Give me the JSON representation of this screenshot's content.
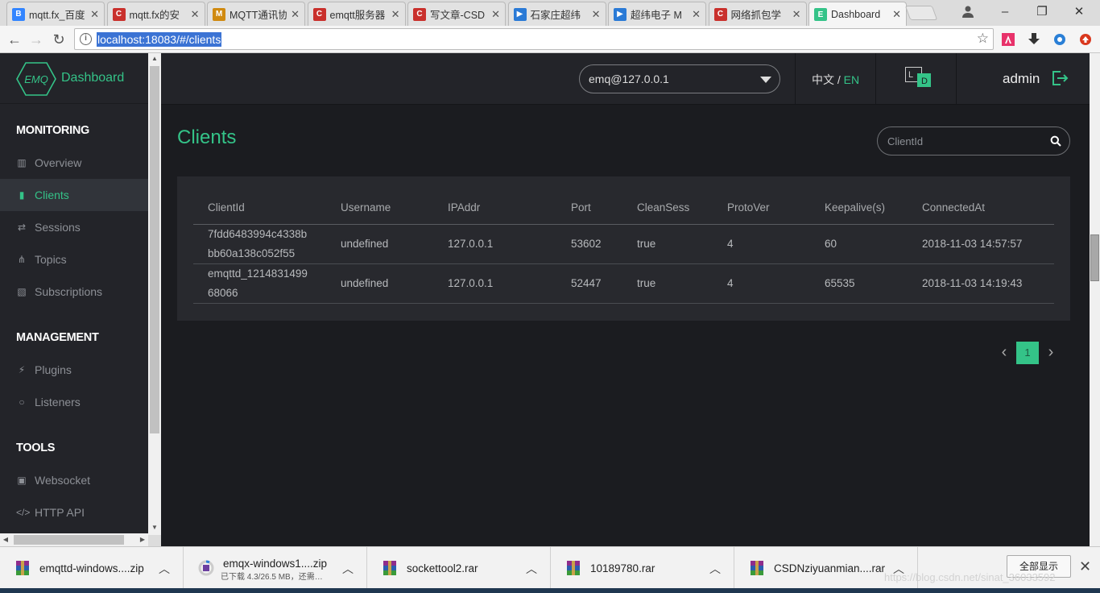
{
  "browser": {
    "tabs": [
      {
        "title": "mqtt.fx_百度",
        "icon": "baidu-icon",
        "color": "#3385ff",
        "glyph": "B"
      },
      {
        "title": "mqtt.fx的安",
        "icon": "csdn-icon",
        "color": "#c9302c",
        "glyph": "C"
      },
      {
        "title": "MQTT通讯协",
        "icon": "mqtt-icon",
        "color": "#d08a10",
        "glyph": "M"
      },
      {
        "title": "emqtt服务器",
        "icon": "csdn-icon",
        "color": "#c9302c",
        "glyph": "C"
      },
      {
        "title": "写文章-CSD",
        "icon": "csdn-icon",
        "color": "#c9302c",
        "glyph": "C"
      },
      {
        "title": "石家庄超纬",
        "icon": "play-icon",
        "color": "#2a7ad6",
        "glyph": "▶"
      },
      {
        "title": "超纬电子 M",
        "icon": "play-icon",
        "color": "#2a7ad6",
        "glyph": "▶"
      },
      {
        "title": "网络抓包学",
        "icon": "csdn-icon",
        "color": "#c9302c",
        "glyph": "C"
      },
      {
        "title": "Dashboard",
        "icon": "emq-icon",
        "color": "#34c388",
        "glyph": "E"
      }
    ],
    "url": "localhost:18083/#/clients"
  },
  "sidebar": {
    "brand_logo": "EMQ",
    "brand_name": "Dashboard",
    "sections": [
      {
        "title": "MONITORING",
        "items": [
          {
            "label": "Overview",
            "icon": "bar-chart-icon",
            "glyph": "▥"
          },
          {
            "label": "Clients",
            "icon": "clients-icon",
            "glyph": "▮",
            "active": true
          },
          {
            "label": "Sessions",
            "icon": "swap-icon",
            "glyph": "⇄"
          },
          {
            "label": "Topics",
            "icon": "topics-icon",
            "glyph": "⋔"
          },
          {
            "label": "Subscriptions",
            "icon": "subscriptions-icon",
            "glyph": "▧"
          }
        ]
      },
      {
        "title": "MANAGEMENT",
        "items": [
          {
            "label": "Plugins",
            "icon": "plug-icon",
            "glyph": "⚡"
          },
          {
            "label": "Listeners",
            "icon": "listeners-icon",
            "glyph": "○"
          }
        ]
      },
      {
        "title": "TOOLS",
        "items": [
          {
            "label": "Websocket",
            "icon": "html5-icon",
            "glyph": "▣"
          },
          {
            "label": "HTTP API",
            "icon": "code-icon",
            "glyph": "</>"
          }
        ]
      }
    ]
  },
  "header": {
    "node": "emq@127.0.0.1",
    "lang_zh": "中文",
    "lang_sep": " / ",
    "lang_en": "EN",
    "layout_letters": [
      "L",
      "D"
    ],
    "user": "admin"
  },
  "main": {
    "title": "Clients",
    "search_placeholder": "ClientId",
    "columns": [
      "ClientId",
      "Username",
      "IPAddr",
      "Port",
      "CleanSess",
      "ProtoVer",
      "Keepalive(s)",
      "ConnectedAt"
    ],
    "rows": [
      {
        "client_id_1": "7fdd6483994c4338b",
        "client_id_2": "bb60a138c052f55",
        "username": "undefined",
        "ip": "127.0.0.1",
        "port": "53602",
        "clean_sess": "true",
        "proto_ver": "4",
        "keepalive": "60",
        "connected_at": "2018-11-03 14:57:57"
      },
      {
        "client_id_1": "emqttd_1214831499",
        "client_id_2": "68066",
        "username": "undefined",
        "ip": "127.0.0.1",
        "port": "52447",
        "clean_sess": "true",
        "proto_ver": "4",
        "keepalive": "65535",
        "connected_at": "2018-11-03 14:19:43"
      }
    ],
    "current_page": "1"
  },
  "downloads": {
    "items": [
      {
        "name": "emqttd-windows....zip",
        "icon": "winrar-icon"
      },
      {
        "name": "emqx-windows1....zip",
        "sub": "已下载 4.3/26.5 MB，还需…",
        "icon": "download-progress-icon"
      },
      {
        "name": "sockettool2.rar",
        "icon": "winrar-icon"
      },
      {
        "name": "10189780.rar",
        "icon": "winrar-icon"
      },
      {
        "name": "CSDNziyuanmian....rar",
        "icon": "winrar-icon"
      }
    ],
    "show_all": "全部显示",
    "watermark": "https://blog.csdn.net/sinat_36033592"
  },
  "colors": {
    "accent": "#34c388",
    "sidebar_bg": "#232429",
    "page_bg": "#1b1c20",
    "card_bg": "#28292e"
  }
}
